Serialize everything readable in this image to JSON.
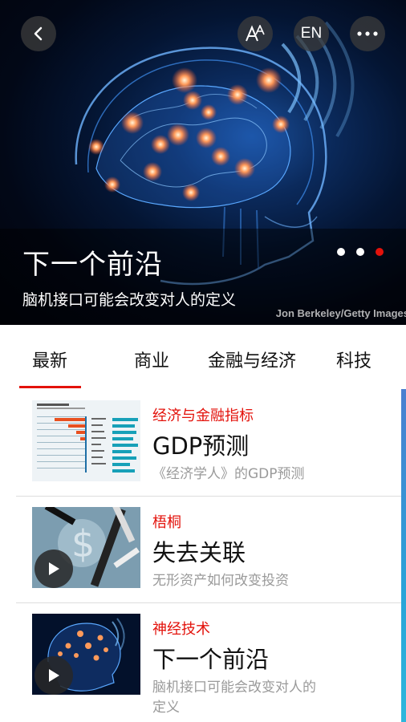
{
  "hero": {
    "title": "下一个前沿",
    "subtitle": "脑机接口可能会改变对人的定义",
    "credit": "Jon Berkeley/Getty Images",
    "carousel_total": 3,
    "carousel_active": 3
  },
  "toolbar": {
    "back_icon": "chevron-left-icon",
    "font_size_icon": "font-size-icon",
    "language_label": "EN",
    "more_icon": "more-icon"
  },
  "tabs": [
    {
      "label": "最新",
      "active": true
    },
    {
      "label": "商业",
      "active": false
    },
    {
      "label": "金融与经济",
      "active": false
    },
    {
      "label": "科技",
      "active": false
    }
  ],
  "articles": [
    {
      "section": "经济与金融指标",
      "title": "GDP预测",
      "description": "《经济学人》的GDP预测",
      "has_video": false
    },
    {
      "section": "梧桐",
      "title": "失去关联",
      "description": "无形资产如何改变投资",
      "has_video": true
    },
    {
      "section": "神经技术",
      "title": "下一个前沿",
      "description": "脑机接口可能会改变对人的定义",
      "has_video": true
    }
  ],
  "colors": {
    "accent": "#e3120b",
    "scroll_accent": "#2aa3d8"
  }
}
